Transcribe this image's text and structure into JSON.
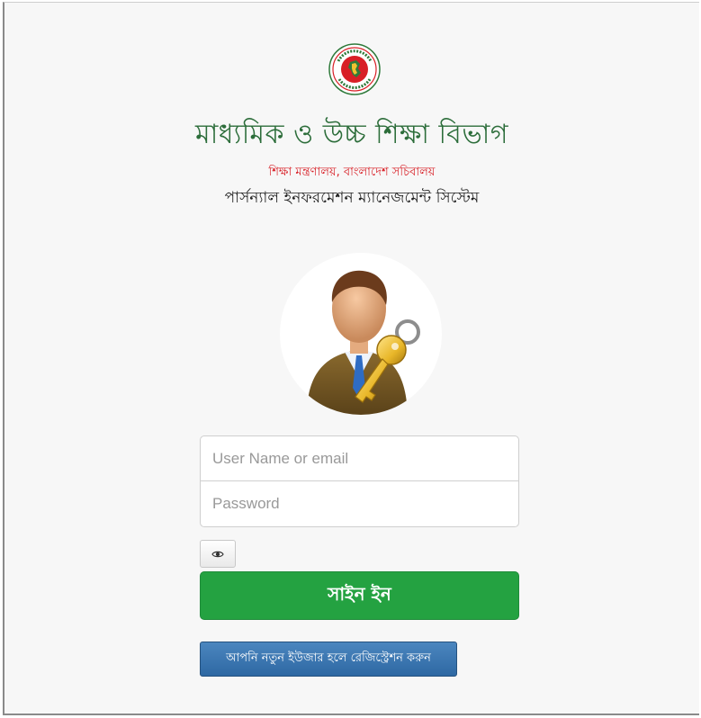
{
  "header": {
    "logo_icon": "government-seal-icon",
    "title": "মাধ্যমিক ও উচ্চ শিক্ষা বিভাগ",
    "subtitle": "শিক্ষা মন্ত্রণালয়, বাংলাদেশ সচিবালয়",
    "system_name": "পার্সন্যাল ইনফরমেশন ম্যানেজমেন্ট সিস্টেম"
  },
  "avatar": {
    "icon": "user-with-key-icon"
  },
  "login_form": {
    "username_placeholder": "User Name or email",
    "username_value": "",
    "password_placeholder": "Password",
    "password_value": "",
    "show_password_icon": "eye-icon",
    "signin_label": "সাইন ইন",
    "register_label": "আপনি নতুন ইউজার হলে রেজিস্ট্রেশন করুন"
  },
  "colors": {
    "title_green": "#2c6d3a",
    "subtitle_red": "#d81f26",
    "signin_green": "#24a241",
    "register_blue": "#2e68a3"
  }
}
